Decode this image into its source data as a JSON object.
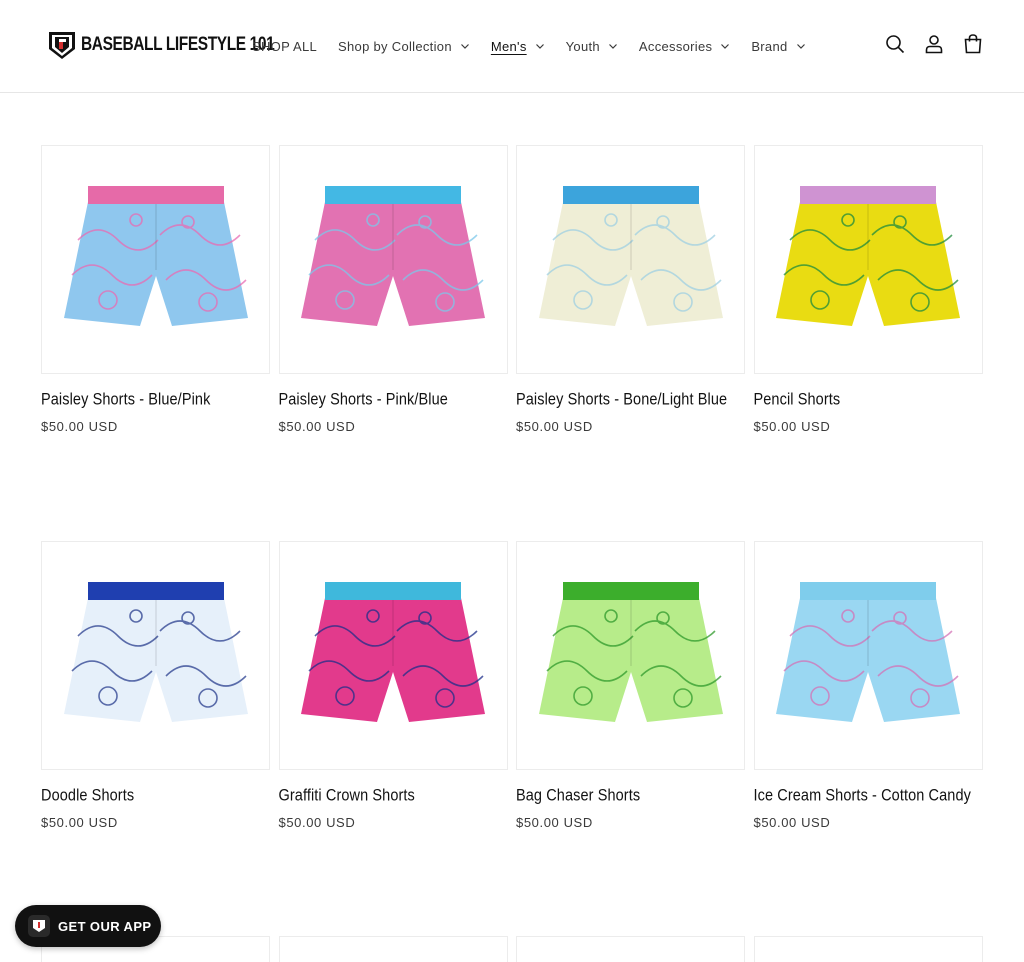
{
  "brand": {
    "name": "BASEBALL LIFESTYLE 101"
  },
  "nav": {
    "items": [
      {
        "label": "SHOP ALL",
        "has_dropdown": false,
        "active": false
      },
      {
        "label": "Shop by Collection",
        "has_dropdown": true,
        "active": false
      },
      {
        "label": "Men's",
        "has_dropdown": true,
        "active": true
      },
      {
        "label": "Youth",
        "has_dropdown": true,
        "active": false
      },
      {
        "label": "Accessories",
        "has_dropdown": true,
        "active": false
      },
      {
        "label": "Brand",
        "has_dropdown": true,
        "active": false
      }
    ]
  },
  "header_icons": [
    "search-icon",
    "account-icon",
    "cart-icon"
  ],
  "products": [
    {
      "title": "Paisley Shorts - Blue/Pink",
      "price": "$50.00 USD",
      "colors": {
        "waist": "#e66aa8",
        "body": "#8fc7ee",
        "pattern": "#e96cb3"
      }
    },
    {
      "title": "Paisley Shorts - Pink/Blue",
      "price": "$50.00 USD",
      "colors": {
        "waist": "#43b8e4",
        "body": "#e272b2",
        "pattern": "#7cc8ea"
      }
    },
    {
      "title": "Paisley Shorts - Bone/Light Blue",
      "price": "$50.00 USD",
      "colors": {
        "waist": "#3ca4dc",
        "body": "#efeed6",
        "pattern": "#9fd0e2"
      }
    },
    {
      "title": "Pencil Shorts",
      "price": "$50.00 USD",
      "colors": {
        "waist": "#cf93d2",
        "body": "#e9dc12",
        "pattern": "#1f8c3d"
      }
    },
    {
      "title": "Doodle Shorts",
      "price": "$50.00 USD",
      "colors": {
        "waist": "#1f3fb0",
        "body": "#e6f0fa",
        "pattern": "#2a3f8f"
      }
    },
    {
      "title": "Graffiti Crown Shorts",
      "price": "$50.00 USD",
      "colors": {
        "waist": "#3fb8dc",
        "body": "#e23a8c",
        "pattern": "#1e2f8a"
      }
    },
    {
      "title": "Bag Chaser Shorts",
      "price": "$50.00 USD",
      "colors": {
        "waist": "#3cae2c",
        "body": "#b7ec8a",
        "pattern": "#2f9a2c"
      }
    },
    {
      "title": "Ice Cream Shorts - Cotton Candy",
      "price": "$50.00 USD",
      "colors": {
        "waist": "#7fcdec",
        "body": "#9ad7f2",
        "pattern": "#d472b6"
      }
    }
  ],
  "app_badge": {
    "label": "GET OUR APP"
  }
}
